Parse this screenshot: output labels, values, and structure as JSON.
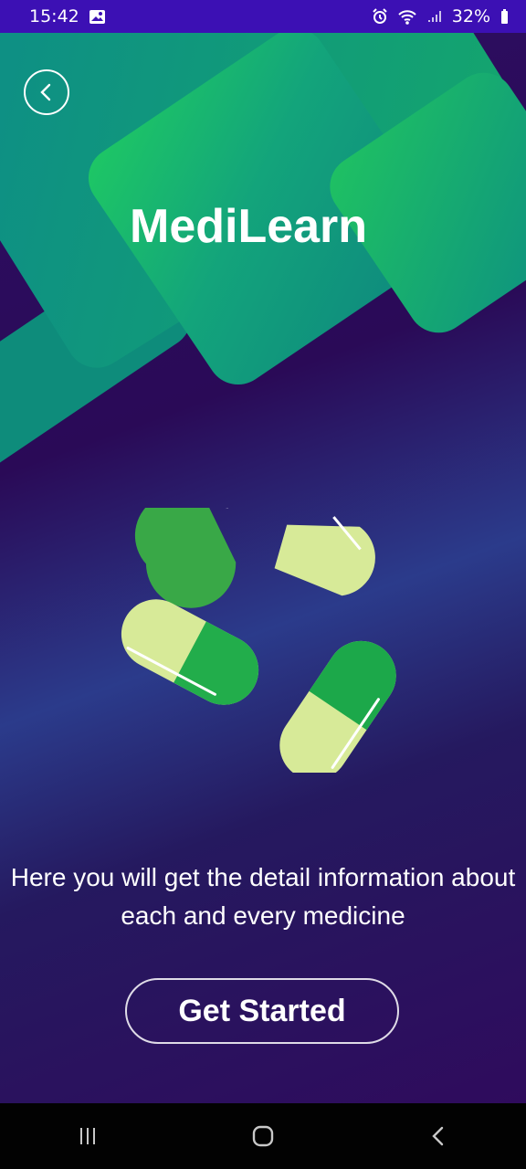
{
  "status_bar": {
    "time": "15:42",
    "battery": "32%",
    "icons": [
      "image-icon",
      "alarm-icon",
      "wifi-icon",
      "signal-icon",
      "battery-icon"
    ]
  },
  "app": {
    "name": "MediLearn",
    "description": "Here you will get the detail information about each and every medicine",
    "button_label": "Get Started"
  },
  "colors": {
    "status_bar": "#3c10b4",
    "background": "#2d0f63",
    "teal": "#11927f",
    "green": "#21b45f",
    "light_pill": "#d8eb9a"
  },
  "icons": {
    "back": "chevron-left-icon",
    "navigation": [
      "recent-apps-icon",
      "home-icon",
      "back-icon"
    ]
  }
}
